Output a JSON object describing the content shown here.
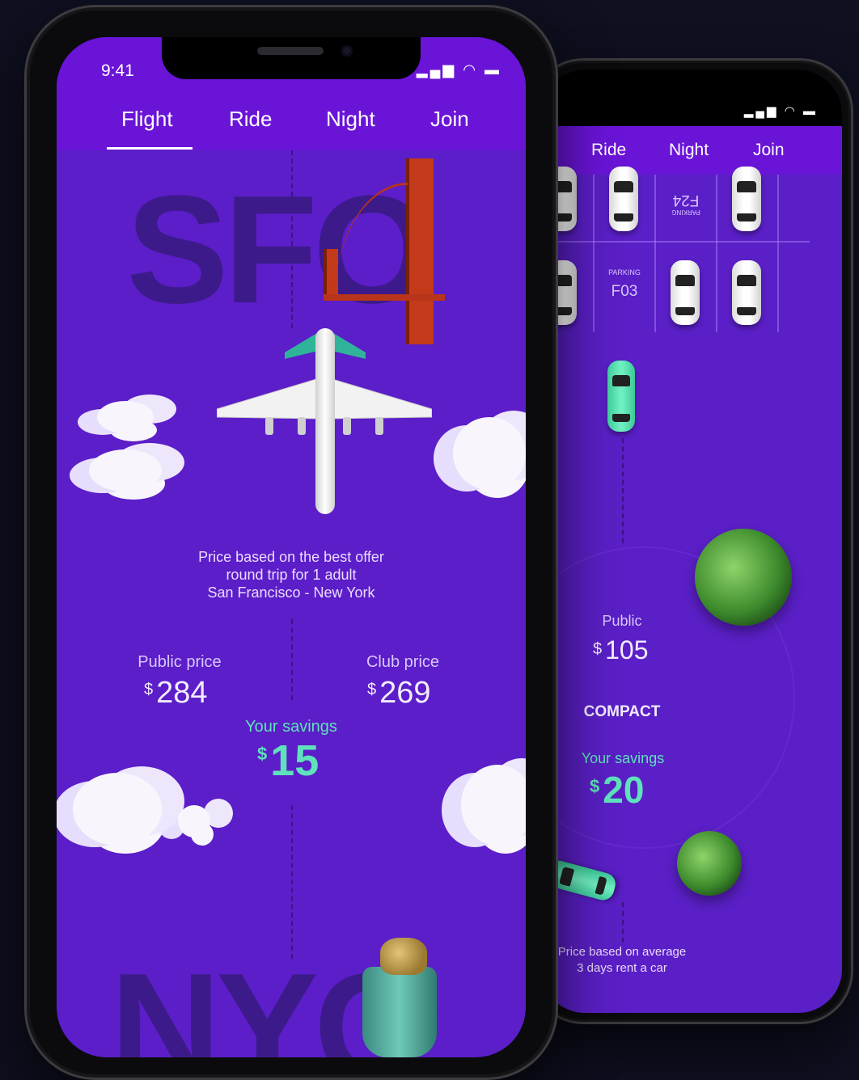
{
  "front_phone": {
    "status": {
      "time": "9:41",
      "icons": "signal wifi battery"
    },
    "tabs": [
      {
        "label": "Flight",
        "active": true
      },
      {
        "label": "Ride",
        "active": false
      },
      {
        "label": "Night",
        "active": false
      },
      {
        "label": "Join",
        "active": false
      }
    ],
    "origin_code": "SFO",
    "destination_code": "NYC",
    "info_lines": [
      "Price based on the best offer",
      "round trip for 1 adult",
      "San Francisco - New York"
    ],
    "public_price": {
      "label": "Public price",
      "currency": "$",
      "value": "284"
    },
    "club_price": {
      "label": "Club price",
      "currency": "$",
      "value": "269"
    },
    "savings": {
      "label": "Your savings",
      "currency": "$",
      "value": "15"
    }
  },
  "back_phone": {
    "tabs": [
      {
        "label": "Ride"
      },
      {
        "label": "Night"
      },
      {
        "label": "Join"
      }
    ],
    "parking": [
      {
        "label": "PARKING",
        "spot": "F24"
      },
      {
        "label": "PARKING",
        "spot": "F03"
      }
    ],
    "public": {
      "label": "Public",
      "currency": "$",
      "value": "105"
    },
    "car_class": "COMPACT",
    "savings": {
      "label": "Your savings",
      "currency": "$",
      "value": "20"
    },
    "info_lines": [
      "Price based on average",
      "3 days rent a car"
    ]
  },
  "colors": {
    "background": "#0f1020",
    "header_purple": "#6a14d8",
    "screen_purple": "#5b1ec8",
    "accent_teal": "#5fe2bc"
  }
}
